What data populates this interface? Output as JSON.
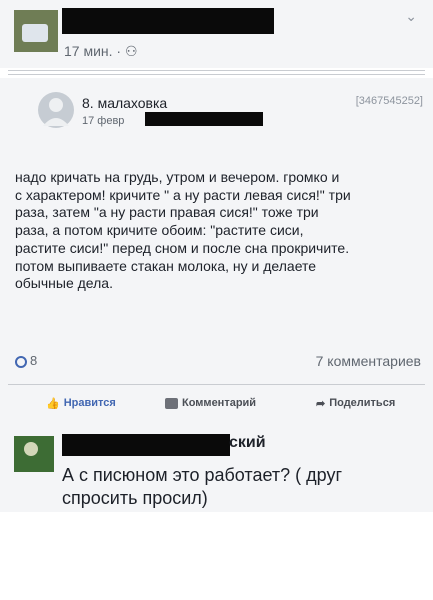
{
  "top_post": {
    "meta": "17 мин. · ⚇"
  },
  "post": {
    "author": "8. малаховка",
    "id_badge": "[3467545252]",
    "date": "17 февр",
    "text": "надо кричать на грудь, утром и вечером. громко и\nс характером! кричите \" а ну расти левая сися!\" три\nраза, затем \"а ну расти правая сися!\" тоже три\nраза, а потом кричите обоим: \"растите сиси,\nрастите сиси!\" перед сном и после сна прокричите.\nпотом выпиваете стакан молока, ну и делаете\nобычные дела.",
    "likes": "8",
    "comments": "7 комментариев",
    "actions": {
      "like": "Нравится",
      "comment": "Комментарий",
      "share": "Поделиться"
    }
  },
  "reply": {
    "name_suffix": "ский",
    "text": "А с писюном это работает? ( друг\nспросить просил)"
  },
  "colors": {
    "accent": "#4267b2",
    "card_bg": "#f4f5f7",
    "redaction": "#0a0a0a"
  }
}
